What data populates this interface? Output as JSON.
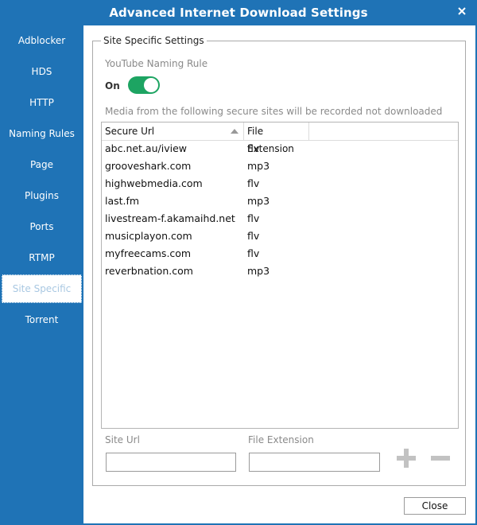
{
  "window": {
    "title": "Advanced Internet Download Settings"
  },
  "sidebar": {
    "items": [
      {
        "label": "Adblocker"
      },
      {
        "label": "HDS"
      },
      {
        "label": "HTTP"
      },
      {
        "label": "Naming Rules"
      },
      {
        "label": "Page"
      },
      {
        "label": "Plugins"
      },
      {
        "label": "Ports"
      },
      {
        "label": "RTMP"
      },
      {
        "label": "Site Specific",
        "active": true
      },
      {
        "label": "Torrent"
      }
    ]
  },
  "site_specific": {
    "group_label": "Site Specific Settings",
    "youtube_naming_rule_label": "YouTube Naming Rule",
    "toggle_state_label": "On",
    "toggle_on": true,
    "note": "Media from the following secure sites will be recorded not downloaded",
    "table": {
      "columns": [
        "Secure Url",
        "File Extension"
      ],
      "rows": [
        {
          "url": "abc.net.au/iview",
          "ext": "flv"
        },
        {
          "url": "grooveshark.com",
          "ext": "mp3"
        },
        {
          "url": "highwebmedia.com",
          "ext": "flv"
        },
        {
          "url": "last.fm",
          "ext": "mp3"
        },
        {
          "url": "livestream-f.akamaihd.net",
          "ext": "flv"
        },
        {
          "url": "musicplayon.com",
          "ext": "flv"
        },
        {
          "url": "myfreecams.com",
          "ext": "flv"
        },
        {
          "url": "reverbnation.com",
          "ext": "mp3"
        }
      ]
    },
    "site_url_label": "Site Url",
    "site_url_value": "",
    "file_ext_label": "File Extension",
    "file_ext_value": ""
  },
  "footer": {
    "close_label": "Close"
  },
  "colors": {
    "accent": "#1f73b6",
    "toggle": "#1da462"
  }
}
